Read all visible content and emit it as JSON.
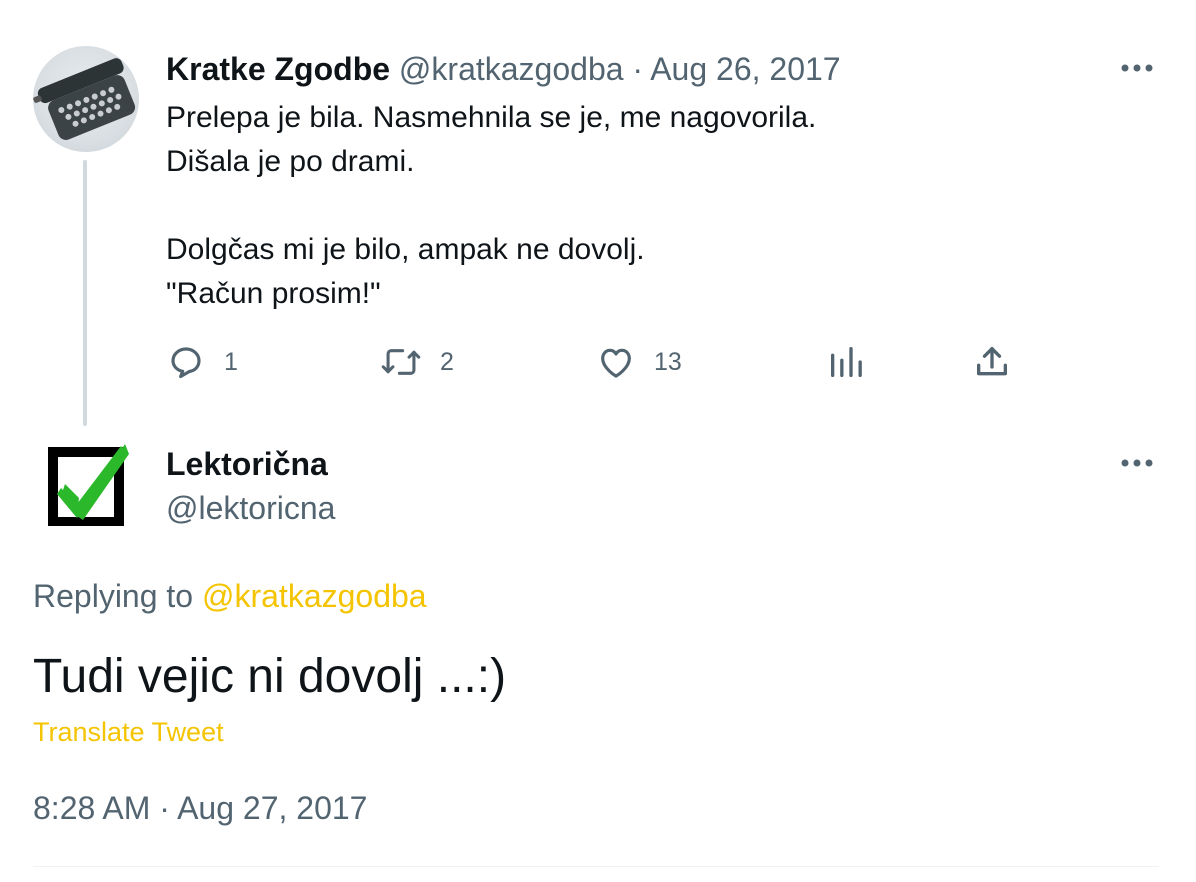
{
  "parent_tweet": {
    "author_name": "Kratke Zgodbe",
    "handle": "@kratkazgodba",
    "separator": "·",
    "date": "Aug 26, 2017",
    "lines": [
      "Prelepa je bila. Nasmehnila se je, me nagovorila.",
      "Dišala je po drami.",
      "",
      "Dolgčas mi je bilo, ampak ne dovolj.",
      "\"Račun prosim!\""
    ],
    "actions": {
      "reply_count": "1",
      "retweet_count": "2",
      "like_count": "13"
    }
  },
  "reply_tweet": {
    "author_name": "Lektorična",
    "handle": "@lektoricna",
    "replying_prefix": "Replying to",
    "replying_to": "@kratkazgodba",
    "text": "Tudi vejic ni dovolj ...:)",
    "translate_label": "Translate Tweet",
    "time": "8:28 AM",
    "separator": "·",
    "date": "Aug 27, 2017"
  },
  "colors": {
    "text_primary": "#0f1419",
    "text_secondary": "#536471",
    "accent": "#f4c400",
    "thread_line": "#cfd9de",
    "checkmark_green": "#2bb82b"
  },
  "icons": {
    "parent_avatar": "typewriter-avatar",
    "reply_avatar": "green-checkmark-box",
    "more": "more-horizontal-icon",
    "reply": "reply-bubble-icon",
    "retweet": "retweet-icon",
    "like": "heart-icon",
    "views": "analytics-icon",
    "share": "share-icon"
  }
}
